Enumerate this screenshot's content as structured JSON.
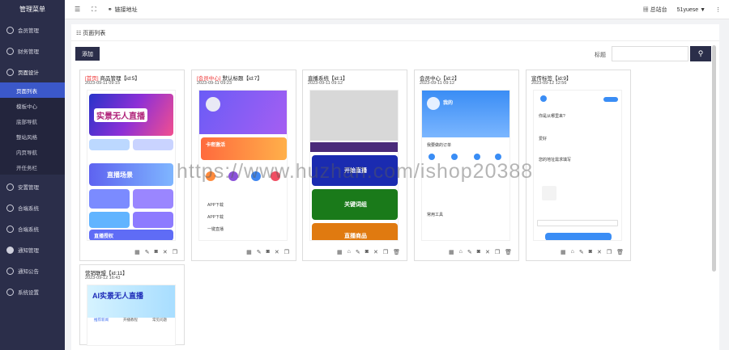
{
  "sidebar": {
    "title": "管理菜单",
    "items": [
      {
        "label": "会员管理"
      },
      {
        "label": "财务管理"
      },
      {
        "label": "页面设计"
      }
    ],
    "subitems": [
      {
        "label": "页面列表"
      },
      {
        "label": "模板中心"
      },
      {
        "label": "底部导航"
      },
      {
        "label": "整站风格"
      },
      {
        "label": "内页导航"
      },
      {
        "label": "开任务栏"
      }
    ],
    "items_after": [
      {
        "label": "安置管理"
      },
      {
        "label": "合端系统"
      },
      {
        "label": "合端系统"
      },
      {
        "label": "通知管理"
      },
      {
        "label": "通知公告"
      },
      {
        "label": "系统设置"
      }
    ]
  },
  "topbar": {
    "link_label": "链接地址",
    "home_label": "总站台",
    "user_label": "51yuese ▼"
  },
  "main": {
    "breadcrumb": "页面列表",
    "add_label": "添加",
    "search_label": "标题",
    "search_placeholder": ""
  },
  "cards": [
    {
      "tag": "[首页]",
      "title": "商品管理【id:5】",
      "date": "2023-09-11 09:15",
      "banner": "实景无人直播",
      "banner2": "直播场景",
      "banner3": "直播授权"
    },
    {
      "tag": "[会员中心]",
      "title": "默认标题【id:7】",
      "date": "2023-09-11 09:23",
      "banner": "卡密激活",
      "row1": "APP下载",
      "row2": "APP下载",
      "row3": "一键直播"
    },
    {
      "tag": "",
      "title": "直播系统【id:1】",
      "date": "2023-09-11 09:12",
      "btn1": "开始直播",
      "btn2": "关键词组",
      "btn3": "直播商品"
    },
    {
      "tag": "",
      "title": "会员中心【id:2】",
      "date": "2023-09-11 09:12",
      "head": "我的",
      "sec1": "我要做的订单",
      "sec2": "常用工具"
    },
    {
      "tag": "",
      "title": "宣传标签【id:9】",
      "date": "2023-09-12 12:56",
      "q1": "你是从哪里来?",
      "q2": "爱好",
      "q3": "您的地址需求填写"
    },
    {
      "tag": "",
      "title": "营销联盟【id:11】",
      "date": "2023-09-12 16:43",
      "banner": "AI实景无人直播",
      "tab1": "推荐新闻",
      "tab2": "开播教程",
      "tab3": "常见问题"
    }
  ],
  "watermark": "https://www.huzhan.com/ishop20388"
}
